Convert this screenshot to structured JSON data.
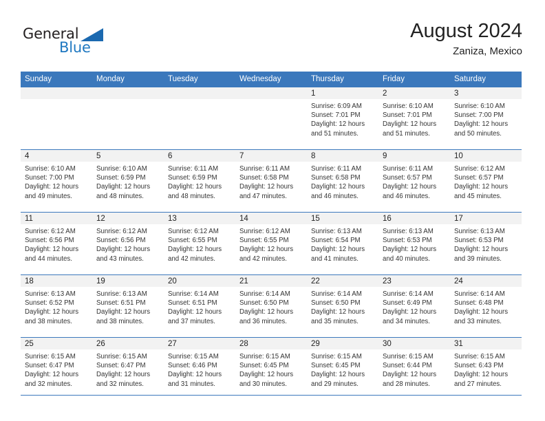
{
  "brand": {
    "name_top": "General",
    "name_bottom": "Blue",
    "accent_color": "#1f78c1",
    "triangle_color": "#1b69b0"
  },
  "header": {
    "title": "August 2024",
    "subtitle": "Zaniza, Mexico"
  },
  "theme": {
    "header_row_bg": "#3b78bc",
    "daynum_band_bg": "#f2f2f2",
    "rule_color": "#3b78bc"
  },
  "weekdays": [
    "Sunday",
    "Monday",
    "Tuesday",
    "Wednesday",
    "Thursday",
    "Friday",
    "Saturday"
  ],
  "weeks": [
    [
      {
        "day": "",
        "sunrise": "",
        "sunset": "",
        "daylight": "",
        "empty": true
      },
      {
        "day": "",
        "sunrise": "",
        "sunset": "",
        "daylight": "",
        "empty": true
      },
      {
        "day": "",
        "sunrise": "",
        "sunset": "",
        "daylight": "",
        "empty": true
      },
      {
        "day": "",
        "sunrise": "",
        "sunset": "",
        "daylight": "",
        "empty": true
      },
      {
        "day": "1",
        "sunrise": "Sunrise: 6:09 AM",
        "sunset": "Sunset: 7:01 PM",
        "daylight": "Daylight: 12 hours and 51 minutes."
      },
      {
        "day": "2",
        "sunrise": "Sunrise: 6:10 AM",
        "sunset": "Sunset: 7:01 PM",
        "daylight": "Daylight: 12 hours and 51 minutes."
      },
      {
        "day": "3",
        "sunrise": "Sunrise: 6:10 AM",
        "sunset": "Sunset: 7:00 PM",
        "daylight": "Daylight: 12 hours and 50 minutes."
      }
    ],
    [
      {
        "day": "4",
        "sunrise": "Sunrise: 6:10 AM",
        "sunset": "Sunset: 7:00 PM",
        "daylight": "Daylight: 12 hours and 49 minutes."
      },
      {
        "day": "5",
        "sunrise": "Sunrise: 6:10 AM",
        "sunset": "Sunset: 6:59 PM",
        "daylight": "Daylight: 12 hours and 48 minutes."
      },
      {
        "day": "6",
        "sunrise": "Sunrise: 6:11 AM",
        "sunset": "Sunset: 6:59 PM",
        "daylight": "Daylight: 12 hours and 48 minutes."
      },
      {
        "day": "7",
        "sunrise": "Sunrise: 6:11 AM",
        "sunset": "Sunset: 6:58 PM",
        "daylight": "Daylight: 12 hours and 47 minutes."
      },
      {
        "day": "8",
        "sunrise": "Sunrise: 6:11 AM",
        "sunset": "Sunset: 6:58 PM",
        "daylight": "Daylight: 12 hours and 46 minutes."
      },
      {
        "day": "9",
        "sunrise": "Sunrise: 6:11 AM",
        "sunset": "Sunset: 6:57 PM",
        "daylight": "Daylight: 12 hours and 46 minutes."
      },
      {
        "day": "10",
        "sunrise": "Sunrise: 6:12 AM",
        "sunset": "Sunset: 6:57 PM",
        "daylight": "Daylight: 12 hours and 45 minutes."
      }
    ],
    [
      {
        "day": "11",
        "sunrise": "Sunrise: 6:12 AM",
        "sunset": "Sunset: 6:56 PM",
        "daylight": "Daylight: 12 hours and 44 minutes."
      },
      {
        "day": "12",
        "sunrise": "Sunrise: 6:12 AM",
        "sunset": "Sunset: 6:56 PM",
        "daylight": "Daylight: 12 hours and 43 minutes."
      },
      {
        "day": "13",
        "sunrise": "Sunrise: 6:12 AM",
        "sunset": "Sunset: 6:55 PM",
        "daylight": "Daylight: 12 hours and 42 minutes."
      },
      {
        "day": "14",
        "sunrise": "Sunrise: 6:12 AM",
        "sunset": "Sunset: 6:55 PM",
        "daylight": "Daylight: 12 hours and 42 minutes."
      },
      {
        "day": "15",
        "sunrise": "Sunrise: 6:13 AM",
        "sunset": "Sunset: 6:54 PM",
        "daylight": "Daylight: 12 hours and 41 minutes."
      },
      {
        "day": "16",
        "sunrise": "Sunrise: 6:13 AM",
        "sunset": "Sunset: 6:53 PM",
        "daylight": "Daylight: 12 hours and 40 minutes."
      },
      {
        "day": "17",
        "sunrise": "Sunrise: 6:13 AM",
        "sunset": "Sunset: 6:53 PM",
        "daylight": "Daylight: 12 hours and 39 minutes."
      }
    ],
    [
      {
        "day": "18",
        "sunrise": "Sunrise: 6:13 AM",
        "sunset": "Sunset: 6:52 PM",
        "daylight": "Daylight: 12 hours and 38 minutes."
      },
      {
        "day": "19",
        "sunrise": "Sunrise: 6:13 AM",
        "sunset": "Sunset: 6:51 PM",
        "daylight": "Daylight: 12 hours and 38 minutes."
      },
      {
        "day": "20",
        "sunrise": "Sunrise: 6:14 AM",
        "sunset": "Sunset: 6:51 PM",
        "daylight": "Daylight: 12 hours and 37 minutes."
      },
      {
        "day": "21",
        "sunrise": "Sunrise: 6:14 AM",
        "sunset": "Sunset: 6:50 PM",
        "daylight": "Daylight: 12 hours and 36 minutes."
      },
      {
        "day": "22",
        "sunrise": "Sunrise: 6:14 AM",
        "sunset": "Sunset: 6:50 PM",
        "daylight": "Daylight: 12 hours and 35 minutes."
      },
      {
        "day": "23",
        "sunrise": "Sunrise: 6:14 AM",
        "sunset": "Sunset: 6:49 PM",
        "daylight": "Daylight: 12 hours and 34 minutes."
      },
      {
        "day": "24",
        "sunrise": "Sunrise: 6:14 AM",
        "sunset": "Sunset: 6:48 PM",
        "daylight": "Daylight: 12 hours and 33 minutes."
      }
    ],
    [
      {
        "day": "25",
        "sunrise": "Sunrise: 6:15 AM",
        "sunset": "Sunset: 6:47 PM",
        "daylight": "Daylight: 12 hours and 32 minutes."
      },
      {
        "day": "26",
        "sunrise": "Sunrise: 6:15 AM",
        "sunset": "Sunset: 6:47 PM",
        "daylight": "Daylight: 12 hours and 32 minutes."
      },
      {
        "day": "27",
        "sunrise": "Sunrise: 6:15 AM",
        "sunset": "Sunset: 6:46 PM",
        "daylight": "Daylight: 12 hours and 31 minutes."
      },
      {
        "day": "28",
        "sunrise": "Sunrise: 6:15 AM",
        "sunset": "Sunset: 6:45 PM",
        "daylight": "Daylight: 12 hours and 30 minutes."
      },
      {
        "day": "29",
        "sunrise": "Sunrise: 6:15 AM",
        "sunset": "Sunset: 6:45 PM",
        "daylight": "Daylight: 12 hours and 29 minutes."
      },
      {
        "day": "30",
        "sunrise": "Sunrise: 6:15 AM",
        "sunset": "Sunset: 6:44 PM",
        "daylight": "Daylight: 12 hours and 28 minutes."
      },
      {
        "day": "31",
        "sunrise": "Sunrise: 6:15 AM",
        "sunset": "Sunset: 6:43 PM",
        "daylight": "Daylight: 12 hours and 27 minutes."
      }
    ]
  ]
}
